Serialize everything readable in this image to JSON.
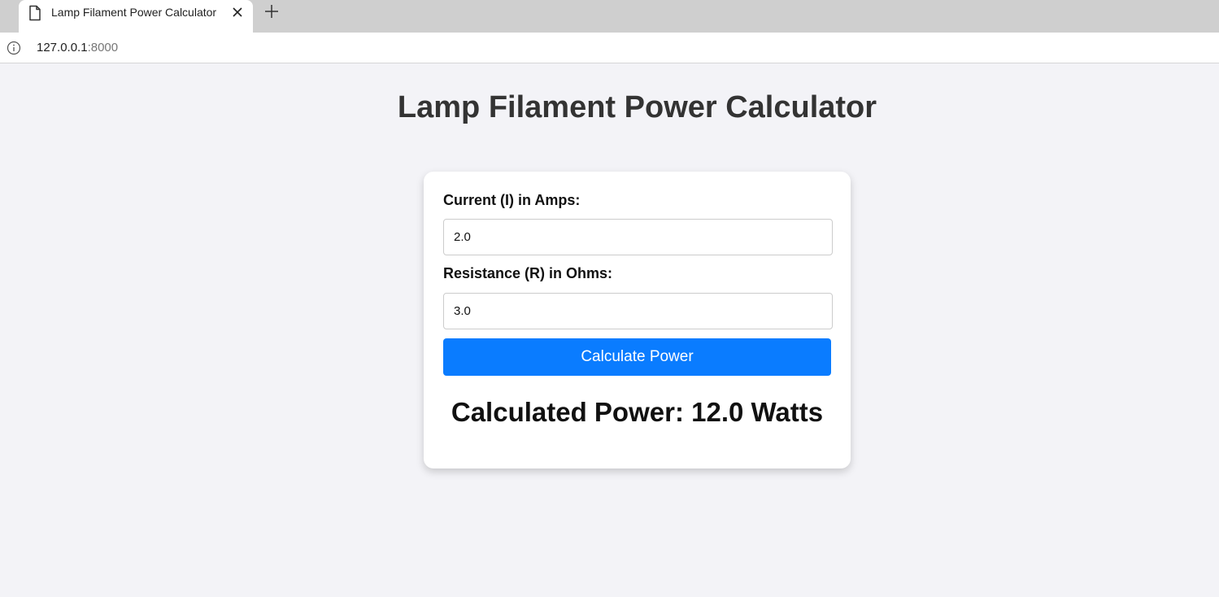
{
  "browser": {
    "tab": {
      "title": "Lamp Filament Power Calculator",
      "favicon_icon": "page-icon",
      "close_icon": "close-icon"
    },
    "new_tab_icon": "plus-icon",
    "address": {
      "host": "127.0.0.1",
      "port": ":8000",
      "info_icon": "info-icon"
    }
  },
  "page": {
    "title": "Lamp Filament Power Calculator",
    "form": {
      "current": {
        "label": "Current (I) in Amps:",
        "value": "2.0"
      },
      "resistance": {
        "label": "Resistance (R) in Ohms:",
        "value": "3.0"
      },
      "submit_label": "Calculate Power"
    },
    "result": {
      "prefix": "Calculated Power: ",
      "value": "12.0",
      "unit": " Watts"
    }
  },
  "colors": {
    "background": "#f3f3f7",
    "card": "#ffffff",
    "accent": "#0a7cff",
    "title_text": "#333333"
  }
}
